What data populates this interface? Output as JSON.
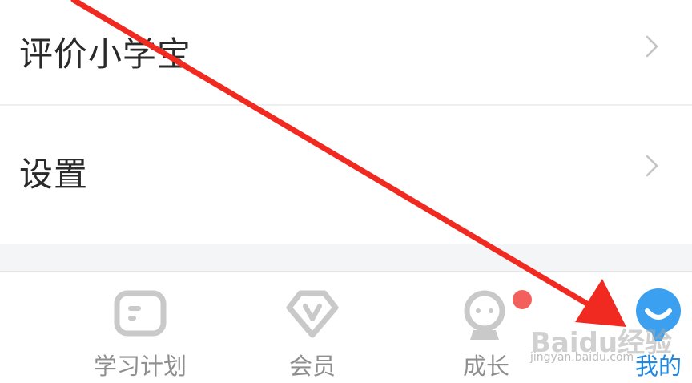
{
  "menu": {
    "items": [
      {
        "label": "评价小学宝",
        "icon": "chevron-right-icon"
      },
      {
        "label": "设置",
        "icon": "chevron-right-icon"
      }
    ]
  },
  "tabbar": {
    "tabs": [
      {
        "label": "学习计划",
        "icon": "study-plan-icon",
        "active": false
      },
      {
        "label": "会员",
        "icon": "vip-icon",
        "active": false
      },
      {
        "label": "成长",
        "icon": "growth-icon",
        "active": false,
        "badge": true
      },
      {
        "label": "我的",
        "icon": "mine-icon",
        "active": true
      }
    ],
    "inactive_color": "#8f8f8f",
    "active_color": "#1e88e5",
    "badge_color": "#f25f5c"
  },
  "annotation": {
    "arrow_color": "#f02a20"
  },
  "watermark": {
    "brand": "Baidu经验",
    "url": "jingyan.baidu.com"
  }
}
